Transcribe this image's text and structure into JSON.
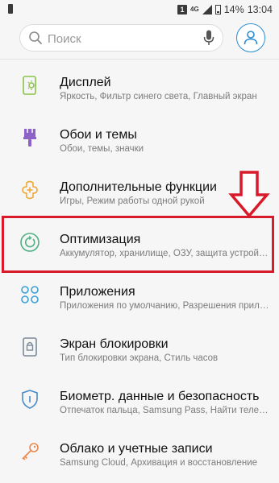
{
  "status_bar": {
    "sim": "1",
    "network": "4G",
    "battery": "14%",
    "time": "13:04"
  },
  "search": {
    "placeholder": "Поиск"
  },
  "settings": [
    {
      "title": "Дисплей",
      "subtitle": "Яркость, Фильтр синего света, Главный экран",
      "icon": "display-icon",
      "color": "#8bc34a"
    },
    {
      "title": "Обои и темы",
      "subtitle": "Обои, темы, значки",
      "icon": "paintbrush-icon",
      "color": "#8e63c8"
    },
    {
      "title": "Дополнительные функции",
      "subtitle": "Игры, Режим работы одной рукой",
      "icon": "puzzle-plus-icon",
      "color": "#f0a839"
    },
    {
      "title": "Оптимизация",
      "subtitle": "Аккумулятор, хранилище, ОЗУ, защита устройства",
      "icon": "optimization-icon",
      "color": "#4caf82"
    },
    {
      "title": "Приложения",
      "subtitle": "Приложения по умолчанию, Разрешения приложений",
      "icon": "apps-grid-icon",
      "color": "#3ba0d6"
    },
    {
      "title": "Экран блокировки",
      "subtitle": "Тип блокировки экрана, Стиль часов",
      "icon": "lock-screen-icon",
      "color": "#7a8a9a"
    },
    {
      "title": "Биометр. данные и безопасность",
      "subtitle": "Отпечаток пальца, Samsung Pass, Найти телефон",
      "icon": "shield-icon",
      "color": "#4a8ac6"
    },
    {
      "title": "Облако и учетные записи",
      "subtitle": "Samsung Cloud, Архивация и восстановление",
      "icon": "key-icon",
      "color": "#e9894f"
    }
  ],
  "annotation_color": "#d81a2b"
}
